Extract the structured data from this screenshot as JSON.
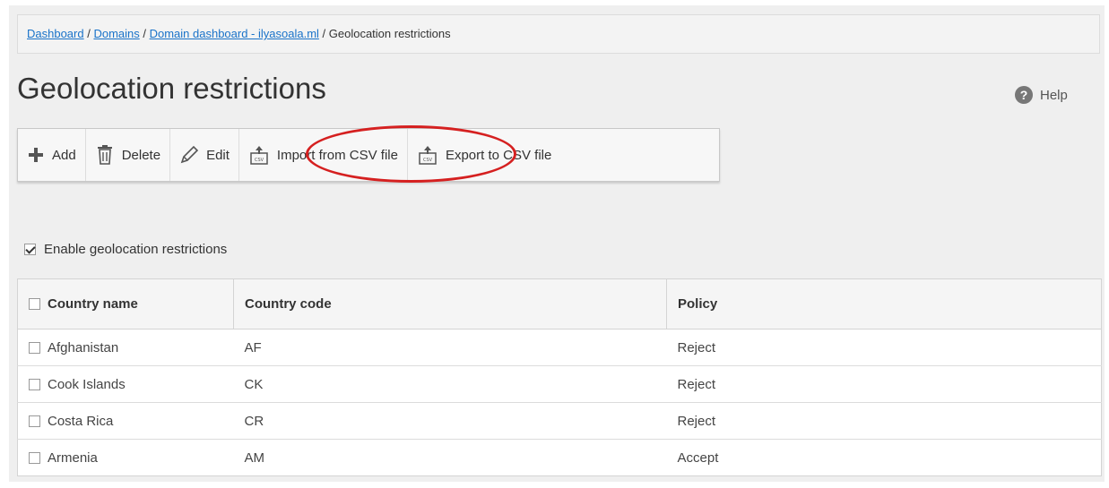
{
  "breadcrumb": {
    "items": [
      "Dashboard",
      "Domains",
      "Domain dashboard - ilyasoala.ml"
    ],
    "separator": " / ",
    "current": "Geolocation restrictions"
  },
  "page": {
    "title": "Geolocation restrictions",
    "help_label": "Help",
    "help_icon": "?"
  },
  "toolbar": {
    "add_label": "Add",
    "delete_label": "Delete",
    "edit_label": "Edit",
    "import_label": "Import from CSV file",
    "export_label": "Export to CSV file"
  },
  "enable_label": "Enable geolocation restrictions",
  "enable_checked": true,
  "table": {
    "headers": [
      "Country name",
      "Country code",
      "Policy"
    ],
    "rows": [
      {
        "name": "Afghanistan",
        "code": "AF",
        "policy": "Reject"
      },
      {
        "name": "Cook Islands",
        "code": "CK",
        "policy": "Reject"
      },
      {
        "name": "Costa Rica",
        "code": "CR",
        "policy": "Reject"
      },
      {
        "name": "Armenia",
        "code": "AM",
        "policy": "Accept"
      }
    ]
  },
  "colors": {
    "link": "#1a73c9",
    "highlight": "#d52020",
    "panel": "#efefef"
  }
}
